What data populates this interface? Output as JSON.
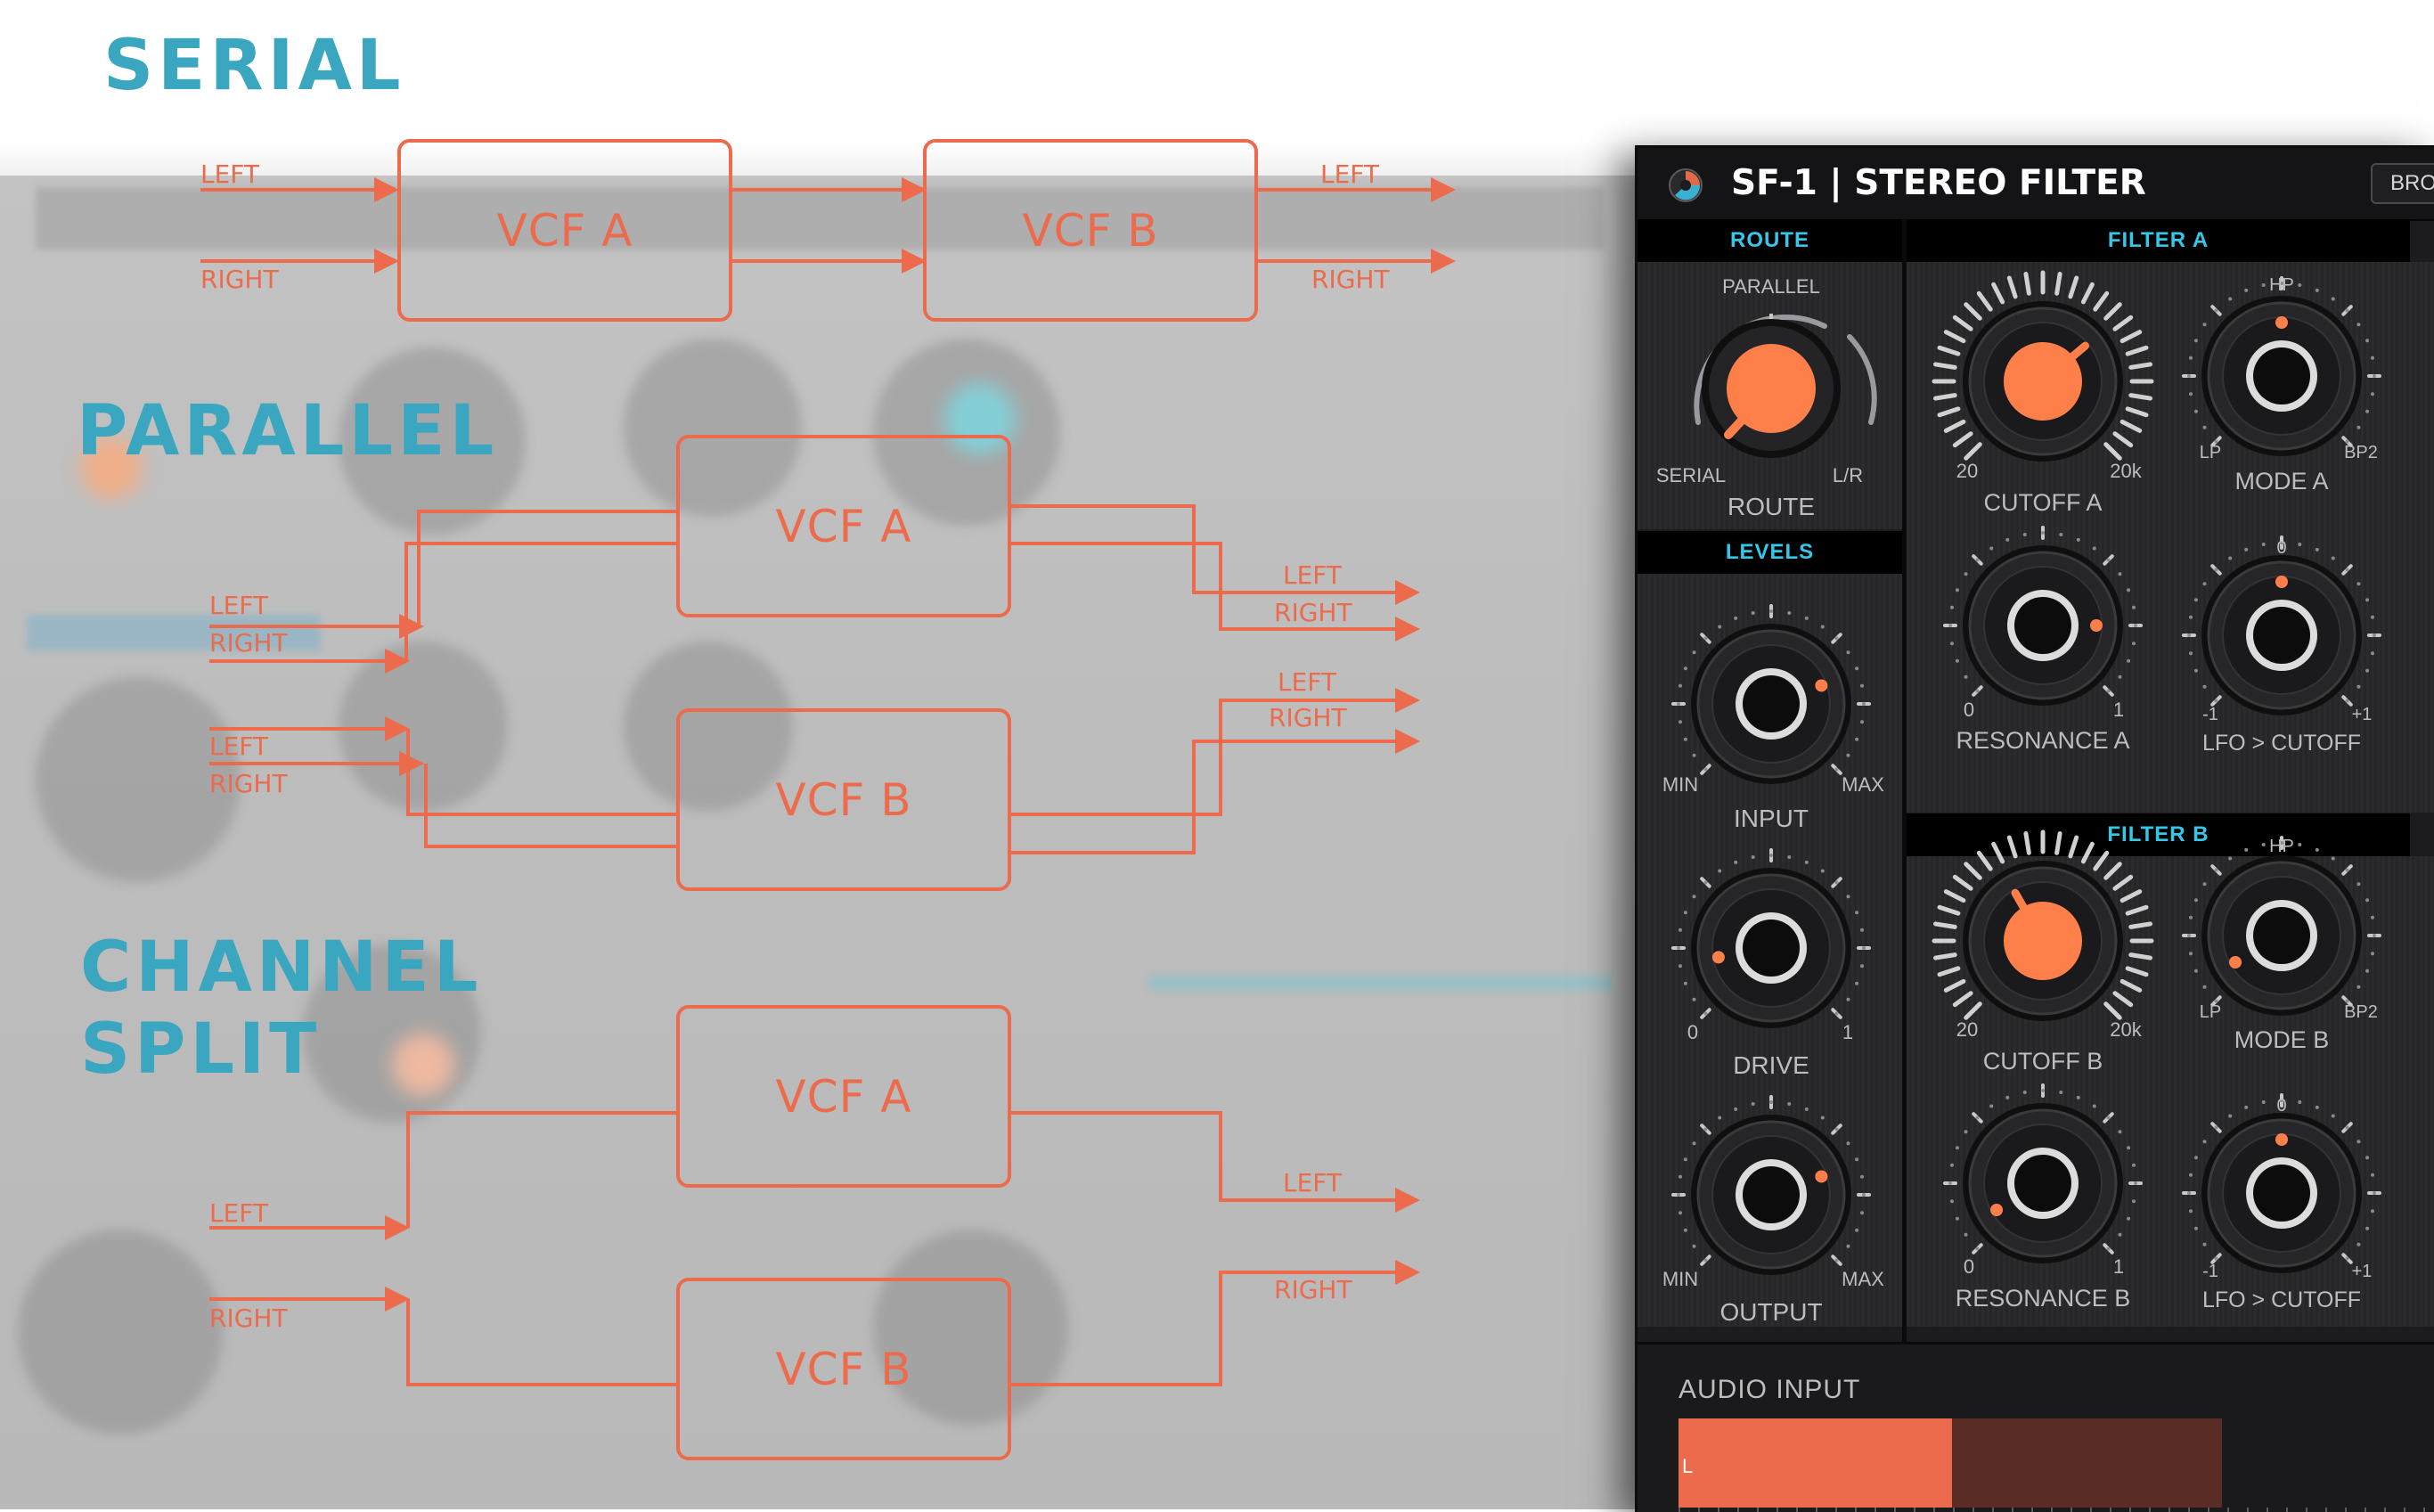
{
  "diagram": {
    "sections": {
      "serial": "SERIAL",
      "parallel": "PARALLEL",
      "channel_split_line1": "CHANNEL",
      "channel_split_line2": "SPLIT"
    },
    "serial": {
      "filter_a": "VCF A",
      "filter_b": "VCF B",
      "in_left": "LEFT",
      "in_right": "RIGHT",
      "out_left": "LEFT",
      "out_right": "RIGHT"
    },
    "parallel": {
      "filter_a": "VCF A",
      "filter_b": "VCF B",
      "in_a_left": "LEFT",
      "in_a_right": "RIGHT",
      "in_b_left": "LEFT",
      "in_b_right": "RIGHT",
      "out_a_left": "LEFT",
      "out_a_right": "RIGHT",
      "out_b_left": "LEFT",
      "out_b_right": "RIGHT"
    },
    "channel_split": {
      "filter_a": "VCF A",
      "filter_b": "VCF B",
      "in_left": "LEFT",
      "in_right": "RIGHT",
      "out_left": "LEFT",
      "out_right": "RIGHT"
    },
    "colors": {
      "accent": "#ec6b4d",
      "title": "#3aa6bf"
    }
  },
  "plugin": {
    "title": "SF-1 | STEREO FILTER",
    "browse_button": "BROW",
    "sections": {
      "route": "ROUTE",
      "levels": "LEVELS",
      "filter_a": "FILTER A",
      "filter_b": "FILTER B"
    },
    "route_knob": {
      "label": "ROUTE",
      "top_label": "PARALLEL",
      "left_label": "SERIAL",
      "right_label": "L/R"
    },
    "input_knob": {
      "label": "INPUT",
      "min_label": "MIN",
      "max_label": "MAX"
    },
    "drive_knob": {
      "label": "DRIVE",
      "min_label": "0",
      "max_label": "1"
    },
    "output_knob": {
      "label": "OUTPUT",
      "min_label": "MIN",
      "max_label": "MAX"
    },
    "cutoff_a": {
      "label": "CUTOFF A",
      "min_label": "20",
      "max_label": "20k"
    },
    "mode_a": {
      "label": "MODE A",
      "top_label": "HP",
      "left_label": "LP",
      "right_label": "BP2"
    },
    "resonance_a": {
      "label": "RESONANCE A",
      "min_label": "0",
      "max_label": "1"
    },
    "lfo_cutoff_a": {
      "label": "LFO > CUTOFF",
      "top_label": "0",
      "min_label": "-1",
      "max_label": "+1"
    },
    "cutoff_b": {
      "label": "CUTOFF B",
      "min_label": "20",
      "max_label": "20k"
    },
    "mode_b": {
      "label": "MODE B",
      "top_label": "HP",
      "left_label": "LP",
      "right_label": "BP2"
    },
    "resonance_b": {
      "label": "RESONANCE B",
      "min_label": "0",
      "max_label": "1"
    },
    "lfo_cutoff_b": {
      "label": "LFO > CUTOFF",
      "top_label": "0",
      "min_label": "-1",
      "max_label": "+1"
    },
    "audio_input": {
      "label": "AUDIO INPUT",
      "left_channel": "L"
    },
    "colors": {
      "accent": "#ff7f4a",
      "section_text": "#35c7e8",
      "panel": "#1c1c1e"
    }
  }
}
